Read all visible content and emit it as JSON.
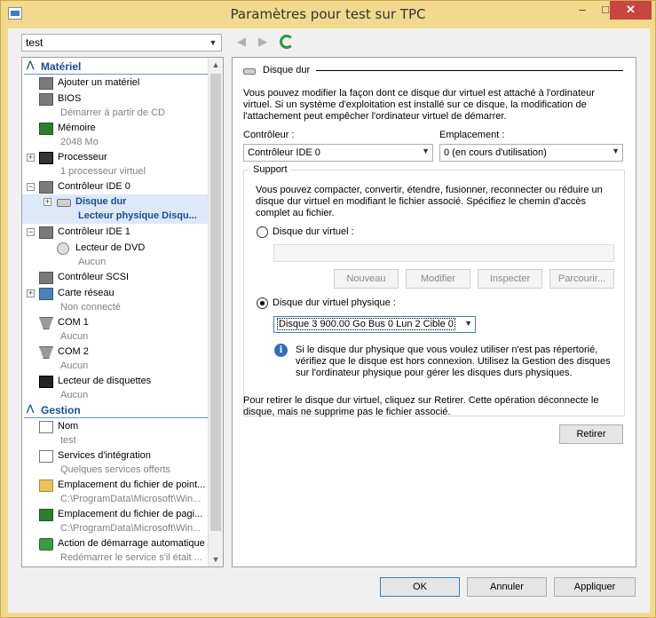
{
  "window": {
    "title": "Paramètres pour test sur TPC",
    "minimize": "–",
    "maximize": "□",
    "close": "✕"
  },
  "toolbar": {
    "vm_select": "test",
    "back": "◀",
    "forward": "▶"
  },
  "sidebar": {
    "sections": [
      {
        "label": "Matériel"
      },
      {
        "label": "Gestion"
      }
    ],
    "items": [
      {
        "label": "Ajouter un matériel",
        "sub": "",
        "icon": "add-hardware-icon"
      },
      {
        "label": "BIOS",
        "sub": "Démarrer à partir de CD",
        "icon": "bios-icon"
      },
      {
        "label": "Mémoire",
        "sub": "2048 Mo",
        "icon": "memory-icon"
      },
      {
        "label": "Processeur",
        "sub": "1 processeur virtuel",
        "icon": "processor-icon"
      },
      {
        "label": "Contrôleur IDE 0",
        "sub": "",
        "icon": "ide-controller-icon"
      },
      {
        "label": "Disque dur",
        "sub": "Lecteur physique Disqu...",
        "icon": "hard-disk-icon"
      },
      {
        "label": "Contrôleur IDE 1",
        "sub": "",
        "icon": "ide-controller-icon"
      },
      {
        "label": "Lecteur de DVD",
        "sub": "Aucun",
        "icon": "dvd-icon"
      },
      {
        "label": "Contrôleur SCSI",
        "sub": "",
        "icon": "scsi-icon"
      },
      {
        "label": "Carte réseau",
        "sub": "Non connecté",
        "icon": "network-icon"
      },
      {
        "label": "COM 1",
        "sub": "Aucun",
        "icon": "com-port-icon"
      },
      {
        "label": "COM 2",
        "sub": "Aucun",
        "icon": "com-port-icon"
      },
      {
        "label": "Lecteur de disquettes",
        "sub": "Aucun",
        "icon": "floppy-icon"
      },
      {
        "label": "Nom",
        "sub": "test",
        "icon": "name-icon"
      },
      {
        "label": "Services d'intégration",
        "sub": "Quelques services offerts",
        "icon": "integration-icon"
      },
      {
        "label": "Emplacement du fichier de point...",
        "sub": "C:\\ProgramData\\Microsoft\\Win...",
        "icon": "snapshot-folder-icon"
      },
      {
        "label": "Emplacement du fichier de pagi...",
        "sub": "C:\\ProgramData\\Microsoft\\Win...",
        "icon": "paging-folder-icon"
      },
      {
        "label": "Action de démarrage automatique",
        "sub": "Redémarrer le service s'il était ...",
        "icon": "autostart-icon"
      }
    ]
  },
  "main": {
    "heading": "Disque dur",
    "intro": "Vous pouvez modifier la façon dont ce disque dur virtuel est attaché à l'ordinateur virtuel. Si un système d'exploitation est installé sur ce disque, la modification de l'attachement peut empêcher l'ordinateur virtuel de démarrer.",
    "controller_label": "Contrôleur :",
    "controller_value": "Contrôleur IDE 0",
    "location_label": "Emplacement :",
    "location_value": "0 (en cours d'utilisation)",
    "support_title": "Support",
    "support_text": "Vous pouvez compacter, convertir, étendre, fusionner, reconnecter ou réduire un disque dur virtuel en modifiant le fichier associé. Spécifiez le chemin d'accès complet au fichier.",
    "virtual_disk_label": "Disque dur virtuel :",
    "virtual_disk_path": "",
    "btn_new": "Nouveau",
    "btn_edit": "Modifier",
    "btn_inspect": "Inspecter",
    "btn_browse": "Parcourir...",
    "physical_disk_label": "Disque dur virtuel physique :",
    "physical_disk_value": "Disque 3 900.00 Go Bus 0 Lun 2 Cible 0",
    "info_text": "Si le disque dur physique que vous voulez utiliser n'est pas répertorié, vérifiez que le disque est hors connexion. Utilisez la Gestion des disques sur l'ordinateur physique pour gérer les disques durs physiques.",
    "remove_text": "Pour retirer le disque dur virtuel, cliquez sur Retirer. Cette opération déconnecte le disque, mais ne supprime pas le fichier associé.",
    "btn_remove": "Retirer"
  },
  "footer": {
    "ok": "OK",
    "cancel": "Annuler",
    "apply": "Appliquer"
  },
  "colors": {
    "title_bar": "#f2d98e",
    "close_button": "#c7463e",
    "section_header": "#1a4b9a",
    "selection": "#dde8f8"
  }
}
